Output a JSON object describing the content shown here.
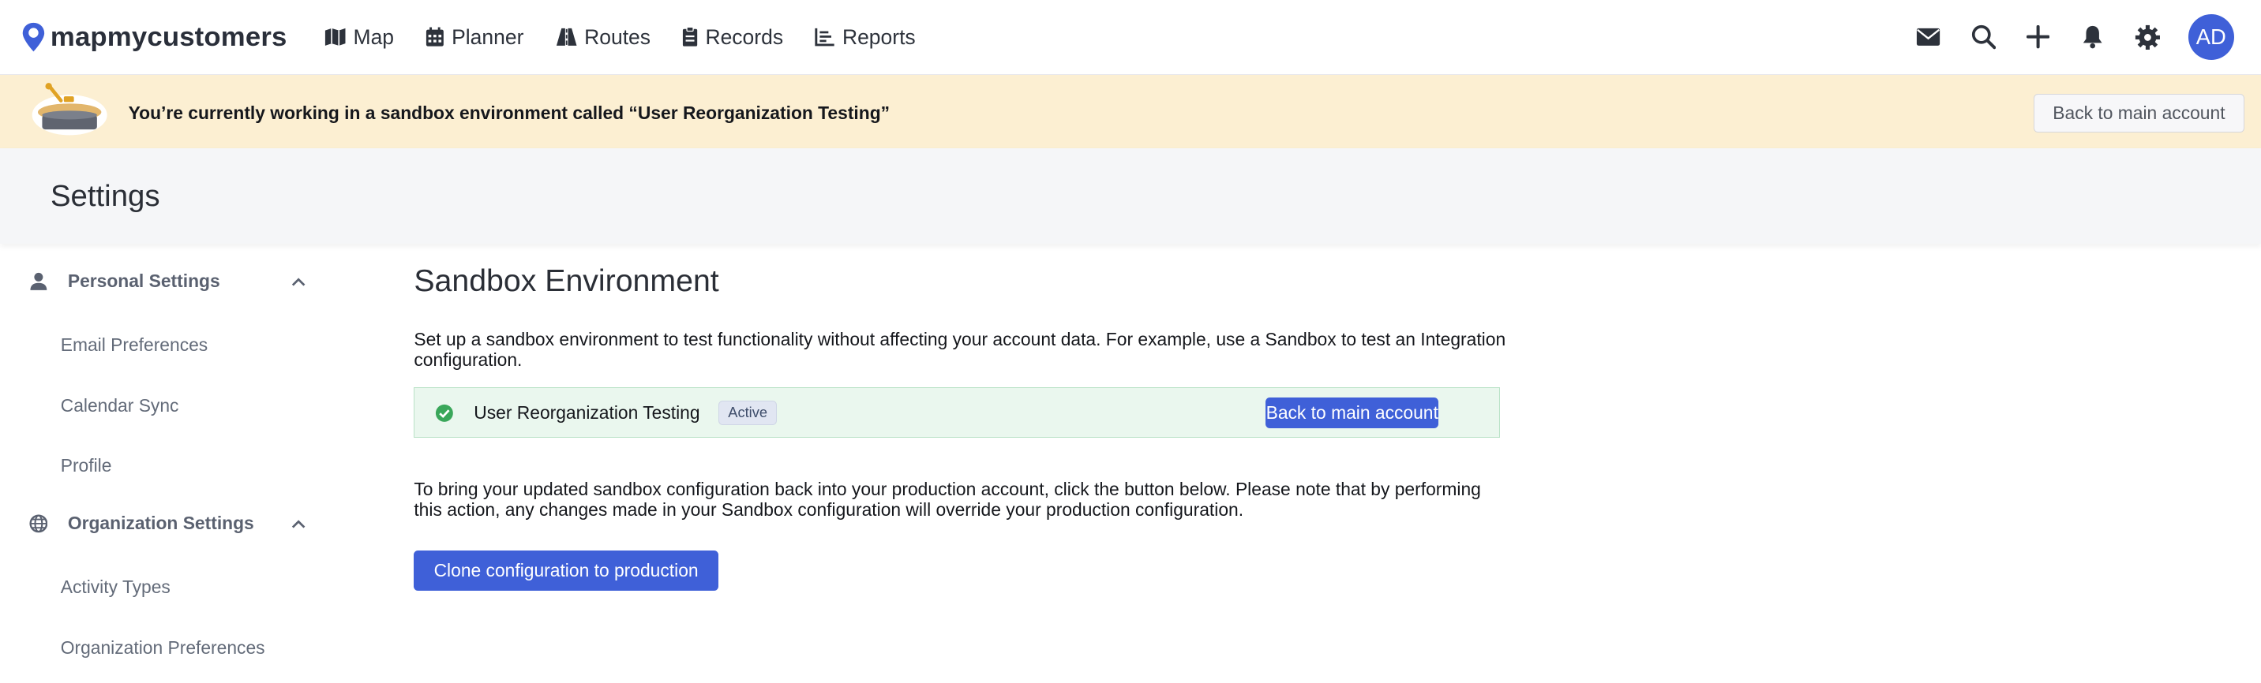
{
  "brand": {
    "name": "mapmycustomers",
    "logo_icon": "map-pin-person-logo",
    "accent_color": "#3f60d8"
  },
  "nav": [
    {
      "label": "Map",
      "icon": "map-icon"
    },
    {
      "label": "Planner",
      "icon": "calendar-icon"
    },
    {
      "label": "Routes",
      "icon": "road-icon"
    },
    {
      "label": "Records",
      "icon": "records-icon"
    },
    {
      "label": "Reports",
      "icon": "reports-icon"
    }
  ],
  "top_actions": [
    "mail-icon",
    "search-icon",
    "plus-icon",
    "bell-icon",
    "gear-icon"
  ],
  "user": {
    "initials": "AD"
  },
  "banner": {
    "message": "You’re currently working in a sandbox environment called “User Reorganization Testing”",
    "button": "Back to main account",
    "background": "#fcefd2"
  },
  "settings": {
    "title": "Settings"
  },
  "sidebar": {
    "groups": [
      {
        "label": "Personal Settings",
        "icon": "person-icon",
        "items": [
          "Email Preferences",
          "Calendar Sync",
          "Profile"
        ]
      },
      {
        "label": "Organization Settings",
        "icon": "globe-icon",
        "items": [
          "Activity Types",
          "Organization Preferences"
        ]
      }
    ]
  },
  "main": {
    "title": "Sandbox Environment",
    "description": "Set up a sandbox environment to test functionality without affecting your account data. For example, use a Sandbox to test an Integration configuration.",
    "sandbox": {
      "name": "User Reorganization Testing",
      "status": "Active",
      "button": "Back to main account"
    },
    "note": "To bring your updated sandbox configuration back into your production account, click the button below. Please note that by performing this action, any changes made in your Sandbox configuration will override your production configuration.",
    "clone_button": "Clone configuration to production"
  }
}
